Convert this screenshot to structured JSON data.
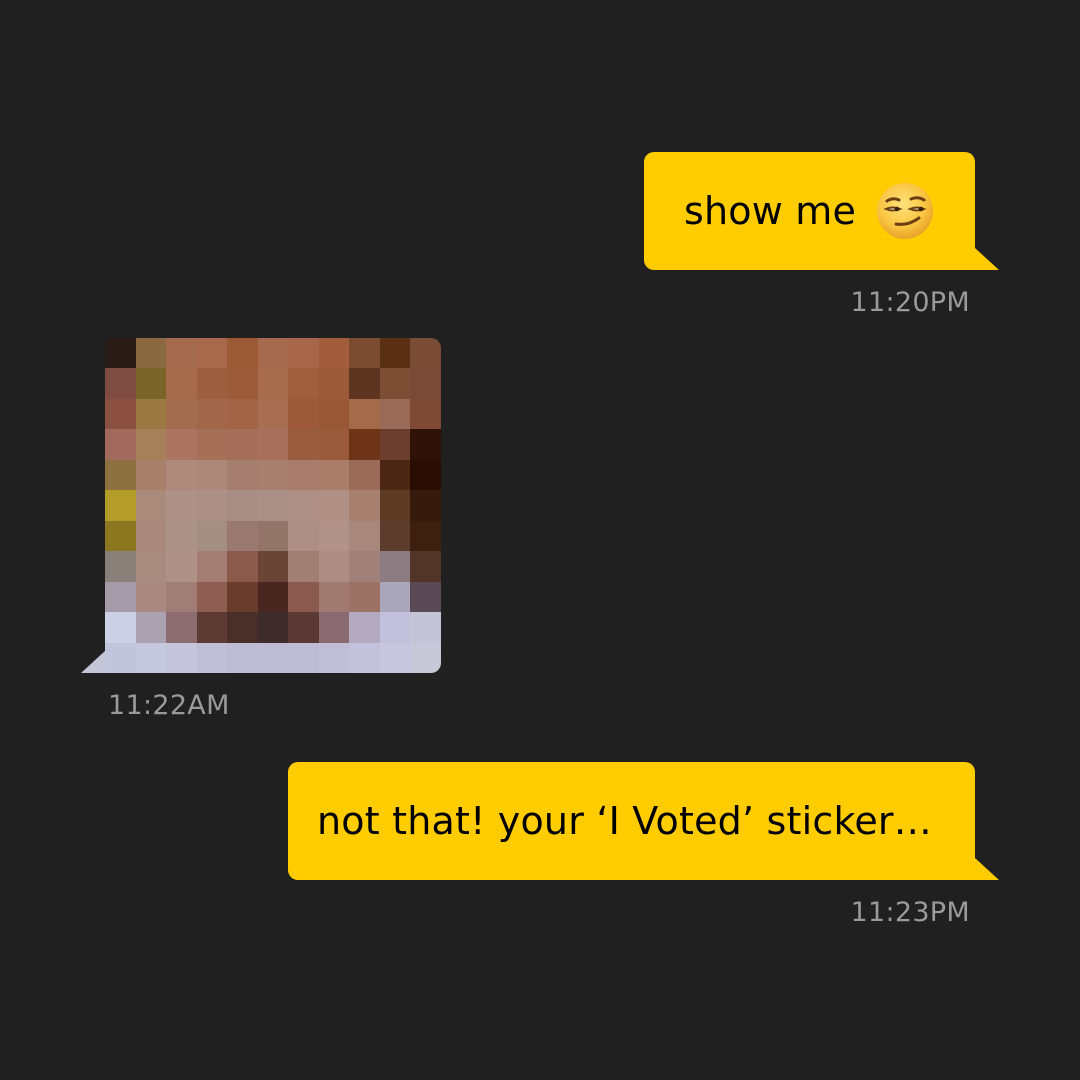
{
  "conversation": {
    "messages": [
      {
        "direction": "outgoing",
        "text": "show me",
        "emoji": "smirking-face",
        "timestamp": "11:20PM"
      },
      {
        "direction": "incoming",
        "type": "pixelated-photo",
        "timestamp": "11:22AM"
      },
      {
        "direction": "outgoing",
        "text": "not that! your ‘I Voted’ sticker…",
        "timestamp": "11:23PM"
      }
    ]
  },
  "colors": {
    "background": "#202020",
    "outgoing_bubble": "#FFCC00",
    "timestamp_text": "#9a9a9a"
  },
  "photo_pixels": [
    [
      "#2a1a16",
      "#8a6840",
      "#a46a50",
      "#a8684c",
      "#9c5a36",
      "#a66a4e",
      "#a8664a",
      "#a25e3c",
      "#7c4c30",
      "#5a3014",
      "#7a4c36"
    ],
    [
      "#7e4c42",
      "#7a6428",
      "#a66a4c",
      "#9e5e40",
      "#9c5c3c",
      "#a86c4e",
      "#a0603e",
      "#9c5a38",
      "#5c3420",
      "#7c4e34",
      "#7a4a36"
    ],
    [
      "#8c5040",
      "#9a7a40",
      "#a46c4e",
      "#a2664a",
      "#a26446",
      "#a86e52",
      "#9c5a3a",
      "#985838",
      "#a46a4a",
      "#9a6a58",
      "#7e4a34"
    ],
    [
      "#a26a5c",
      "#a68058",
      "#aa7460",
      "#a67058",
      "#a46e58",
      "#a8705c",
      "#9a5c3e",
      "#9a5a3c",
      "#6e3418",
      "#6c3e2e",
      "#2e1208"
    ],
    [
      "#8c7040",
      "#a8806a",
      "#ae8a7c",
      "#ac887a",
      "#a67e70",
      "#a87e6c",
      "#a87c6c",
      "#aa7c6a",
      "#9c6a58",
      "#4c2814",
      "#2a0e04"
    ],
    [
      "#b49c28",
      "#aa8a7a",
      "#ae9288",
      "#ac9086",
      "#a68e84",
      "#a89086",
      "#ae9086",
      "#b09084",
      "#a88070",
      "#5e3c24",
      "#361a0c"
    ],
    [
      "#8c7620",
      "#a8887a",
      "#aa9288",
      "#a48e84",
      "#9a7a70",
      "#927468",
      "#ac8e84",
      "#b0928a",
      "#a8887c",
      "#5c3c2c",
      "#3e200e"
    ],
    [
      "#8a807a",
      "#a88c80",
      "#ae9288",
      "#a47e72",
      "#8a5a4a",
      "#6a4434",
      "#a07e72",
      "#ae8c84",
      "#a08078",
      "#8c7c82",
      "#523428"
    ],
    [
      "#a49aa8",
      "#a88880",
      "#a07e76",
      "#8e5e52",
      "#6a3c2c",
      "#4a2620",
      "#8a5a4e",
      "#a07a70",
      "#9c7266",
      "#aaa6bc",
      "#5a4a56"
    ],
    [
      "#ccd0e6",
      "#aaa2b0",
      "#8c6c6e",
      "#5e3a34",
      "#4a2e2a",
      "#3e2c2a",
      "#5a3834",
      "#886a70",
      "#b4aac0",
      "#c2c0da",
      "#c4c4d8"
    ],
    [
      "#c2c4dc",
      "#c6c8de",
      "#c4c4da",
      "#c0bed4",
      "#bebcd2",
      "#bebcd4",
      "#bebcd2",
      "#c0bed6",
      "#c4c2da",
      "#c6c6de",
      "#c8c8d8"
    ]
  ]
}
